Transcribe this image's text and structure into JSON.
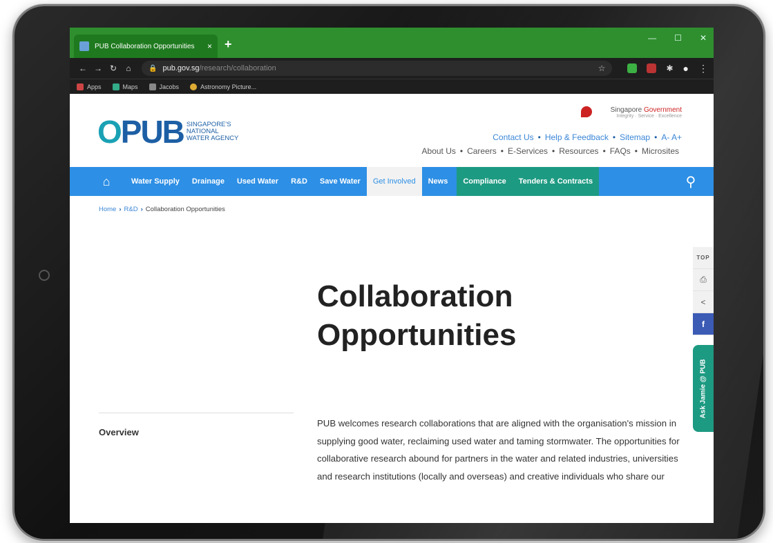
{
  "browser": {
    "tab_title": "PUB Collaboration Opportunities",
    "tab_close": "×",
    "new_tab": "+",
    "url_host": "pub.gov.sg",
    "url_path": "/research/collaboration",
    "bookmarks": [
      "Apps",
      "Maps",
      "Jacobs",
      "Astronomy Picture..."
    ]
  },
  "site": {
    "logo_text": "PUB",
    "logo_tagline": [
      "SINGAPORE'S",
      "NATIONAL",
      "WATER AGENCY"
    ],
    "gov_name_a": "Singapore",
    "gov_name_b": "Government",
    "gov_motto": "Integrity · Service · Excellence",
    "util_links": [
      "Contact Us",
      "Help & Feedback",
      "Sitemap",
      "A- A+"
    ],
    "main_links": [
      "About Us",
      "Careers",
      "E-Services",
      "Resources",
      "FAQs",
      "Microsites"
    ]
  },
  "nav": {
    "items": [
      "Water Supply",
      "Drainage",
      "Used Water",
      "R&D",
      "Save Water",
      "Get Involved",
      "News"
    ],
    "green_items": [
      "Compliance",
      "Tenders & Contracts"
    ]
  },
  "breadcrumb": {
    "home": "Home",
    "section": "R&D",
    "current": "Collaboration Opportunities"
  },
  "content": {
    "title_line1": "Collaboration",
    "title_line2": "Opportunities",
    "sidebar_label": "Overview",
    "body": "PUB welcomes research collaborations that are aligned with the organisation's mission in supplying good water, reclaiming used water and taming stormwater. The opportunities for collaborative research abound for partners in the water and related industries, universities and research institutions (locally and overseas) and creative individuals who share our"
  },
  "tools": {
    "top": "TOP",
    "facebook": "f",
    "ask_jamie": "Ask Jamie @ PUB"
  },
  "colors": {
    "tab_green": "#2f8f2f",
    "nav_blue": "#2d8fe5",
    "nav_teal": "#1d9a82",
    "brand_blue": "#1d5fa5",
    "facebook": "#3b5bb5"
  }
}
